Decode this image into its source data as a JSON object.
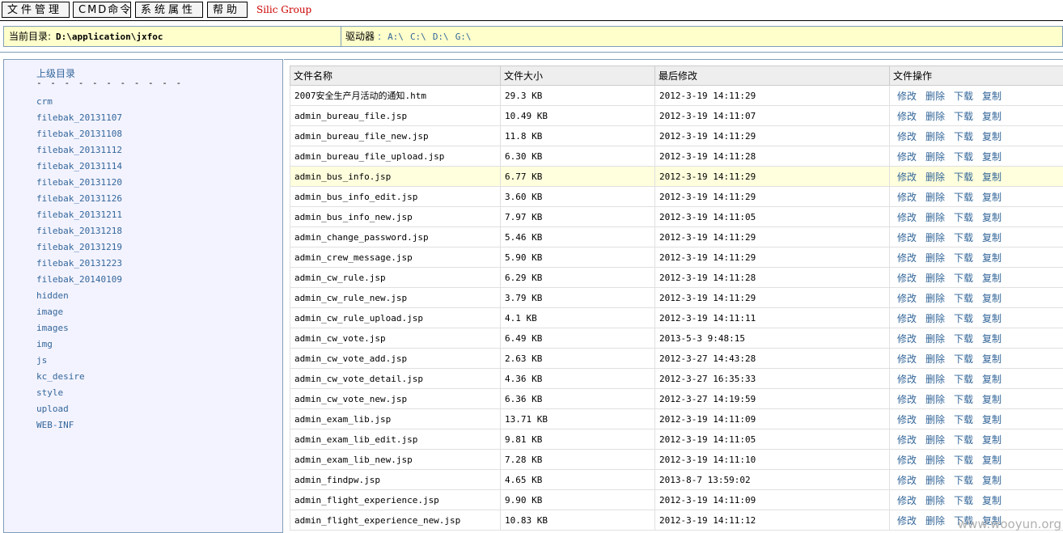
{
  "menu": {
    "items": [
      "文件管理",
      "CMD命令",
      "系统属性",
      "帮助"
    ],
    "brand": "Silic Group"
  },
  "pathbar": {
    "label": "当前目录:",
    "path": "D:\\application\\jxfoc",
    "drives_label": "驱动器",
    "drives_colon": ":",
    "drives": [
      "A:\\",
      "C:\\",
      "D:\\",
      "G:\\"
    ]
  },
  "sidebar": {
    "parent": "上级目录",
    "separator": "- - - - - - - - - - -",
    "dirs": [
      "crm",
      "filebak_20131107",
      "filebak_20131108",
      "filebak_20131112",
      "filebak_20131114",
      "filebak_20131120",
      "filebak_20131126",
      "filebak_20131211",
      "filebak_20131218",
      "filebak_20131219",
      "filebak_20131223",
      "filebak_20140109",
      "hidden",
      "image",
      "images",
      "img",
      "js",
      "kc_desire",
      "style",
      "upload",
      "WEB-INF"
    ]
  },
  "table": {
    "headers": [
      "文件名称",
      "文件大小",
      "最后修改",
      "文件操作"
    ],
    "ops": [
      "修改",
      "删除",
      "下载",
      "复制"
    ],
    "highlighted_row": 4,
    "rows": [
      {
        "name": "2007安全生产月活动的通知.htm",
        "size": "29.3 KB",
        "mtime": "2012-3-19 14:11:29"
      },
      {
        "name": "admin_bureau_file.jsp",
        "size": "10.49 KB",
        "mtime": "2012-3-19 14:11:07"
      },
      {
        "name": "admin_bureau_file_new.jsp",
        "size": "11.8 KB",
        "mtime": "2012-3-19 14:11:29"
      },
      {
        "name": "admin_bureau_file_upload.jsp",
        "size": "6.30 KB",
        "mtime": "2012-3-19 14:11:28"
      },
      {
        "name": "admin_bus_info.jsp",
        "size": "6.77 KB",
        "mtime": "2012-3-19 14:11:29"
      },
      {
        "name": "admin_bus_info_edit.jsp",
        "size": "3.60 KB",
        "mtime": "2012-3-19 14:11:29"
      },
      {
        "name": "admin_bus_info_new.jsp",
        "size": "7.97 KB",
        "mtime": "2012-3-19 14:11:05"
      },
      {
        "name": "admin_change_password.jsp",
        "size": "5.46 KB",
        "mtime": "2012-3-19 14:11:29"
      },
      {
        "name": "admin_crew_message.jsp",
        "size": "5.90 KB",
        "mtime": "2012-3-19 14:11:29"
      },
      {
        "name": "admin_cw_rule.jsp",
        "size": "6.29 KB",
        "mtime": "2012-3-19 14:11:28"
      },
      {
        "name": "admin_cw_rule_new.jsp",
        "size": "3.79 KB",
        "mtime": "2012-3-19 14:11:29"
      },
      {
        "name": "admin_cw_rule_upload.jsp",
        "size": "4.1 KB",
        "mtime": "2012-3-19 14:11:11"
      },
      {
        "name": "admin_cw_vote.jsp",
        "size": "6.49 KB",
        "mtime": "2013-5-3 9:48:15"
      },
      {
        "name": "admin_cw_vote_add.jsp",
        "size": "2.63 KB",
        "mtime": "2012-3-27 14:43:28"
      },
      {
        "name": "admin_cw_vote_detail.jsp",
        "size": "4.36 KB",
        "mtime": "2012-3-27 16:35:33"
      },
      {
        "name": "admin_cw_vote_new.jsp",
        "size": "6.36 KB",
        "mtime": "2012-3-27 14:19:59"
      },
      {
        "name": "admin_exam_lib.jsp",
        "size": "13.71 KB",
        "mtime": "2012-3-19 14:11:09"
      },
      {
        "name": "admin_exam_lib_edit.jsp",
        "size": "9.81 KB",
        "mtime": "2012-3-19 14:11:05"
      },
      {
        "name": "admin_exam_lib_new.jsp",
        "size": "7.28 KB",
        "mtime": "2012-3-19 14:11:10"
      },
      {
        "name": "admin_findpw.jsp",
        "size": "4.65 KB",
        "mtime": "2013-8-7 13:59:02"
      },
      {
        "name": "admin_flight_experience.jsp",
        "size": "9.90 KB",
        "mtime": "2012-3-19 14:11:09"
      },
      {
        "name": "admin_flight_experience_new.jsp",
        "size": "10.83 KB",
        "mtime": "2012-3-19 14:11:12"
      }
    ]
  },
  "watermark": "www.wooyun.org"
}
